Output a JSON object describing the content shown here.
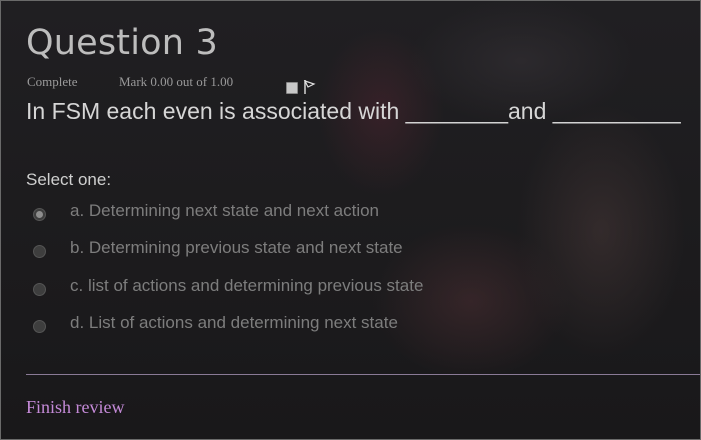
{
  "question": {
    "title": "Question 3",
    "status": "Complete",
    "mark": "Mark 0.00 out of 1.00",
    "text": "In FSM each even is associated with ________and __________"
  },
  "flag": {
    "icon": "flag-icon",
    "checked": false
  },
  "answers": {
    "prompt": "Select one:",
    "options": [
      {
        "label": "a. Determining next state and next action",
        "selected": true
      },
      {
        "label": "b. Determining previous state and next state",
        "selected": false
      },
      {
        "label": "c. list of actions and determining previous state",
        "selected": false
      },
      {
        "label": "d. List of actions and determining next state",
        "selected": false
      }
    ]
  },
  "footer": {
    "finish_label": "Finish review"
  },
  "colors": {
    "accent": "#c58ad8",
    "divider": "#8a7a96"
  }
}
